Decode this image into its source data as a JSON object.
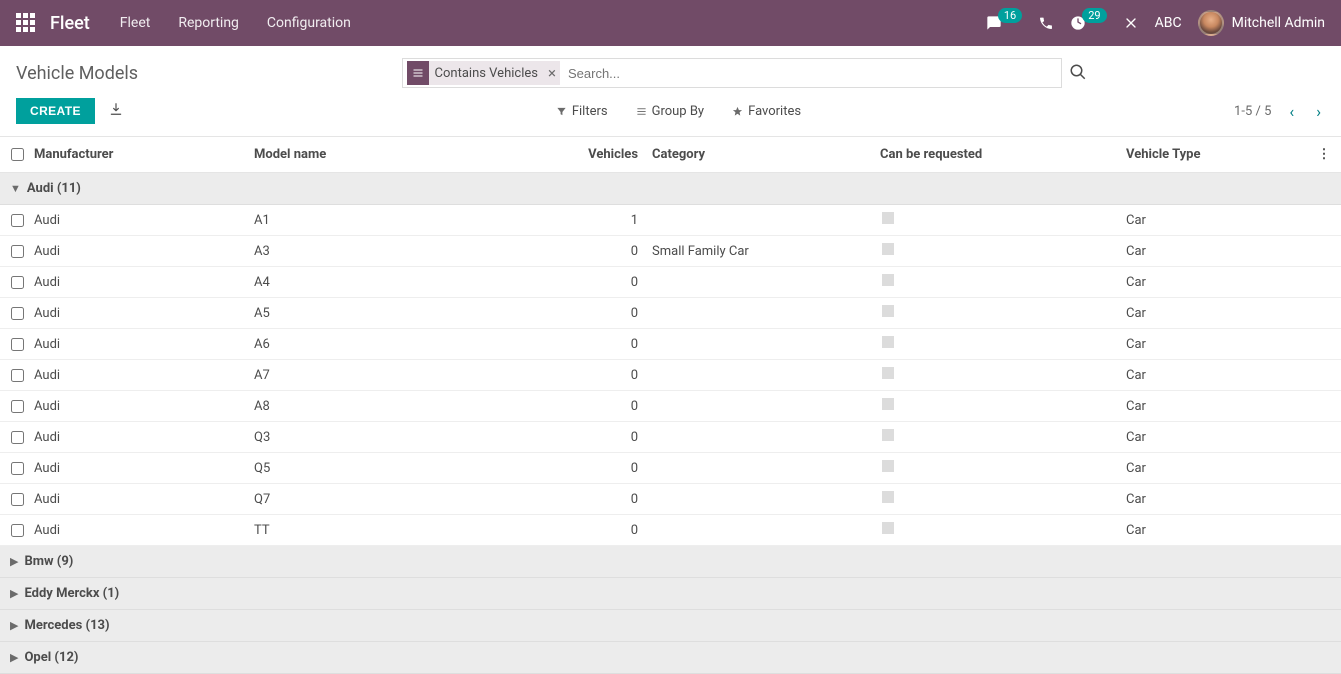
{
  "topnav": {
    "brand": "Fleet",
    "menu": [
      "Fleet",
      "Reporting",
      "Configuration"
    ],
    "discuss_count": "16",
    "activity_count": "29",
    "company": "ABC",
    "user": "Mitchell Admin"
  },
  "control": {
    "title": "Vehicle Models",
    "facet_label": "Contains Vehicles",
    "search_placeholder": "Search...",
    "create": "CREATE",
    "filters": "Filters",
    "groupby": "Group By",
    "favorites": "Favorites",
    "pager": "1-5 / 5"
  },
  "columns": {
    "manufacturer": "Manufacturer",
    "model": "Model name",
    "vehicles": "Vehicles",
    "category": "Category",
    "can_requested": "Can be requested",
    "vehicle_type": "Vehicle Type"
  },
  "groups": [
    {
      "name": "Audi",
      "count": "(11)",
      "expanded": true,
      "rows": [
        {
          "manufacturer": "Audi",
          "model": "A1",
          "vehicles": "1",
          "category": "",
          "vehicle_type": "Car"
        },
        {
          "manufacturer": "Audi",
          "model": "A3",
          "vehicles": "0",
          "category": "Small Family Car",
          "vehicle_type": "Car"
        },
        {
          "manufacturer": "Audi",
          "model": "A4",
          "vehicles": "0",
          "category": "",
          "vehicle_type": "Car"
        },
        {
          "manufacturer": "Audi",
          "model": "A5",
          "vehicles": "0",
          "category": "",
          "vehicle_type": "Car"
        },
        {
          "manufacturer": "Audi",
          "model": "A6",
          "vehicles": "0",
          "category": "",
          "vehicle_type": "Car"
        },
        {
          "manufacturer": "Audi",
          "model": "A7",
          "vehicles": "0",
          "category": "",
          "vehicle_type": "Car"
        },
        {
          "manufacturer": "Audi",
          "model": "A8",
          "vehicles": "0",
          "category": "",
          "vehicle_type": "Car"
        },
        {
          "manufacturer": "Audi",
          "model": "Q3",
          "vehicles": "0",
          "category": "",
          "vehicle_type": "Car"
        },
        {
          "manufacturer": "Audi",
          "model": "Q5",
          "vehicles": "0",
          "category": "",
          "vehicle_type": "Car"
        },
        {
          "manufacturer": "Audi",
          "model": "Q7",
          "vehicles": "0",
          "category": "",
          "vehicle_type": "Car"
        },
        {
          "manufacturer": "Audi",
          "model": "TT",
          "vehicles": "0",
          "category": "",
          "vehicle_type": "Car"
        }
      ]
    },
    {
      "name": "Bmw",
      "count": "(9)",
      "expanded": false,
      "rows": []
    },
    {
      "name": "Eddy Merckx",
      "count": "(1)",
      "expanded": false,
      "rows": []
    },
    {
      "name": "Mercedes",
      "count": "(13)",
      "expanded": false,
      "rows": []
    },
    {
      "name": "Opel",
      "count": "(12)",
      "expanded": false,
      "rows": []
    }
  ]
}
